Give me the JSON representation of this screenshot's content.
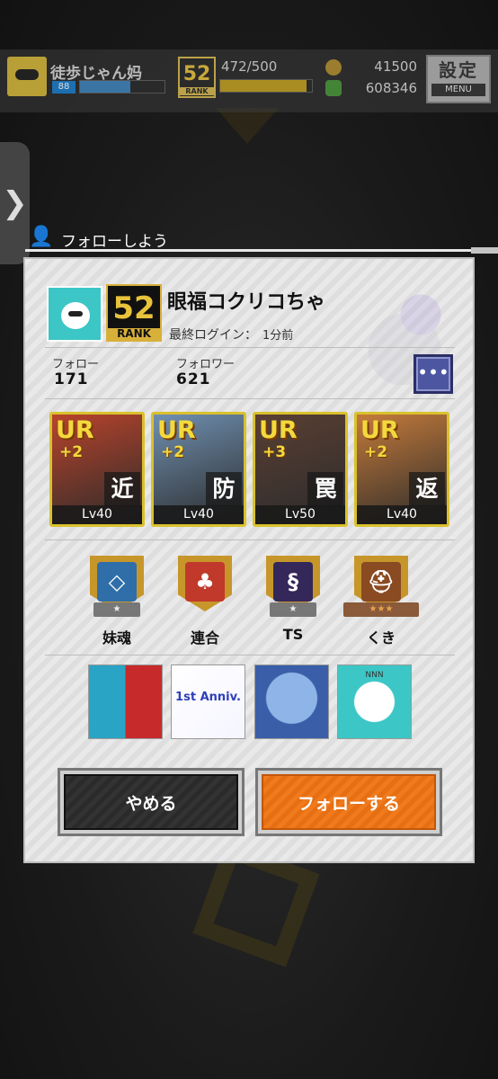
{
  "header": {
    "player_name": "徒歩じゃん妈",
    "level_badge": "88",
    "level_progress": 0.6,
    "rank": "52",
    "rank_label": "RANK",
    "stamina": "472/500",
    "stamina_progress": 0.944,
    "coins": "41500",
    "gems": "608346",
    "menu_kanji": "設定",
    "menu_label": "MENU"
  },
  "side_tab": {
    "glyph": "❯"
  },
  "section": {
    "title": "フォローしよう",
    "icon": "person-add-icon"
  },
  "profile": {
    "name": "眼福コクリコちゃ",
    "rank": "52",
    "rank_label": "RANK",
    "last_login_label": "最終ログイン：",
    "last_login_value": "1分前",
    "follow_label": "フォロー",
    "follow_count": "171",
    "follower_label": "フォロワー",
    "follower_count": "621",
    "more_glyph": "•••"
  },
  "cards": [
    {
      "rarity": "UR",
      "plus": "+2",
      "type": "近",
      "level": "Lv40",
      "bg": "#b8432b"
    },
    {
      "rarity": "UR",
      "plus": "+2",
      "type": "防",
      "level": "Lv40",
      "bg": "#6f8fb0"
    },
    {
      "rarity": "UR",
      "plus": "+3",
      "type": "罠",
      "level": "Lv50",
      "bg": "#5a3f33"
    },
    {
      "rarity": "UR",
      "plus": "+2",
      "type": "返",
      "level": "Lv40",
      "bg": "#c47a3a"
    }
  ],
  "medals": [
    {
      "label": "妹魂",
      "glyph": "◇",
      "stars": "★",
      "color": "#2f6ea8",
      "tier": "silver"
    },
    {
      "label": "連合",
      "glyph": "♣",
      "stars": "",
      "color": "#c0392b",
      "tier": "gold"
    },
    {
      "label": "TS",
      "glyph": "§",
      "stars": "★",
      "color": "#34285a",
      "tier": "silver"
    },
    {
      "label": "くき",
      "glyph": "⛑",
      "stars": "★★★",
      "color": "#8a4a22",
      "tier": "bronze"
    }
  ],
  "stamps": [
    {
      "name": "stamp-face-split",
      "text": ""
    },
    {
      "name": "stamp-1st-anniv",
      "text": "1st Anniv."
    },
    {
      "name": "stamp-rem",
      "text": ""
    },
    {
      "name": "stamp-nnn",
      "text": "NNN"
    }
  ],
  "buttons": {
    "cancel": "やめる",
    "follow": "フォローする"
  },
  "colors": {
    "follow_button": "#f07a1c",
    "card_frame": "#d9c12c",
    "more_button": "#4d56a0"
  }
}
